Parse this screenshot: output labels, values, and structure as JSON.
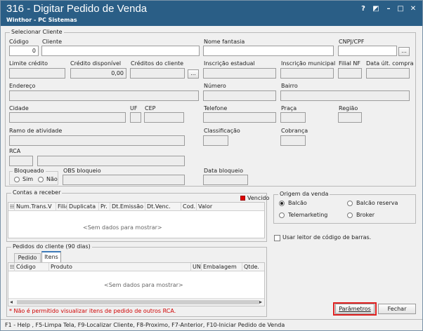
{
  "window": {
    "title": "316 - Digitar Pedido de Venda",
    "subtitle": "Winthor - PC Sistemas",
    "buttons": {
      "help": "?",
      "restore": "◩",
      "minimize": "–",
      "maximize": "□",
      "close": "✕"
    }
  },
  "client": {
    "group_label": "Selecionar Cliente",
    "codigo": {
      "label": "Código",
      "value": "0"
    },
    "cliente": {
      "label": "Cliente",
      "value": ""
    },
    "nome_fantasia": {
      "label": "Nome fantasia",
      "value": ""
    },
    "cnpj": {
      "label": "CNPJ/CPF",
      "value": "",
      "button": "..."
    },
    "limite_credito": {
      "label": "Limite crédito",
      "value": ""
    },
    "credito_disponivel": {
      "label": "Crédito disponível",
      "value": "0,00"
    },
    "creditos_cliente": {
      "label": "Créditos do cliente",
      "value": "",
      "button": "..."
    },
    "inscricao_estadual": {
      "label": "Inscrição estadual",
      "value": ""
    },
    "inscricao_municipal": {
      "label": "Inscrição municipal",
      "value": ""
    },
    "filial_nf": {
      "label": "Filial NF",
      "value": ""
    },
    "data_ult_compra": {
      "label": "Data últ. compra",
      "value": ""
    },
    "endereco": {
      "label": "Endereço",
      "value": ""
    },
    "numero": {
      "label": "Número",
      "value": ""
    },
    "bairro": {
      "label": "Bairro",
      "value": ""
    },
    "cidade": {
      "label": "Cidade",
      "value": ""
    },
    "uf": {
      "label": "UF",
      "value": ""
    },
    "cep": {
      "label": "CEP",
      "value": ""
    },
    "telefone": {
      "label": "Telefone",
      "value": ""
    },
    "praca": {
      "label": "Praça",
      "value": ""
    },
    "regiao": {
      "label": "Região",
      "value": ""
    },
    "ramo_atividade": {
      "label": "Ramo de atividade",
      "value": ""
    },
    "classificacao": {
      "label": "Classificação",
      "value": ""
    },
    "cobranca": {
      "label": "Cobrança",
      "value": ""
    },
    "rca": {
      "label": "RCA",
      "code": "",
      "name": ""
    },
    "bloqueado": {
      "label": "Bloqueado",
      "sim": "Sim",
      "nao": "Não"
    },
    "obs_bloqueio": {
      "label": "OBS bloqueio",
      "value": ""
    },
    "data_bloqueio": {
      "label": "Data bloqueio",
      "value": ""
    }
  },
  "contas": {
    "label": "Contas a receber",
    "legend": "Vencido",
    "legend_color": "#e00000",
    "columns": [
      "Num.Trans.V",
      "Filia",
      "Duplicata",
      "Pr.",
      "Dt.Emissão",
      "Dt.Venc.",
      "Cod.",
      "Valor"
    ],
    "empty": "<Sem dados para mostrar>"
  },
  "origem": {
    "label": "Origem da venda",
    "options": [
      "Balcão",
      "Balcão reserva",
      "Telemarketing",
      "Broker"
    ],
    "selected": "Balcão"
  },
  "leitor": {
    "label": "Usar leitor de código de barras."
  },
  "pedidos": {
    "label": "Pedidos do cliente (90 dias)",
    "tabs": [
      "Pedido",
      "Itens"
    ],
    "active_tab": "Itens",
    "columns": [
      "Código",
      "Produto",
      "UN",
      "Embalagem",
      "Qtde."
    ],
    "empty": "<Sem dados para mostrar>",
    "warning": "* Não é permitido visualizar itens de pedido de outros RCA."
  },
  "actions": {
    "parametros": "Parâmetros",
    "fechar": "Fechar"
  },
  "statusbar": "F1 - Help , F5-Limpa Tela, F9-Localizar Cliente, F8-Proximo, F7-Anterior, F10-Iniciar Pedido de Venda"
}
